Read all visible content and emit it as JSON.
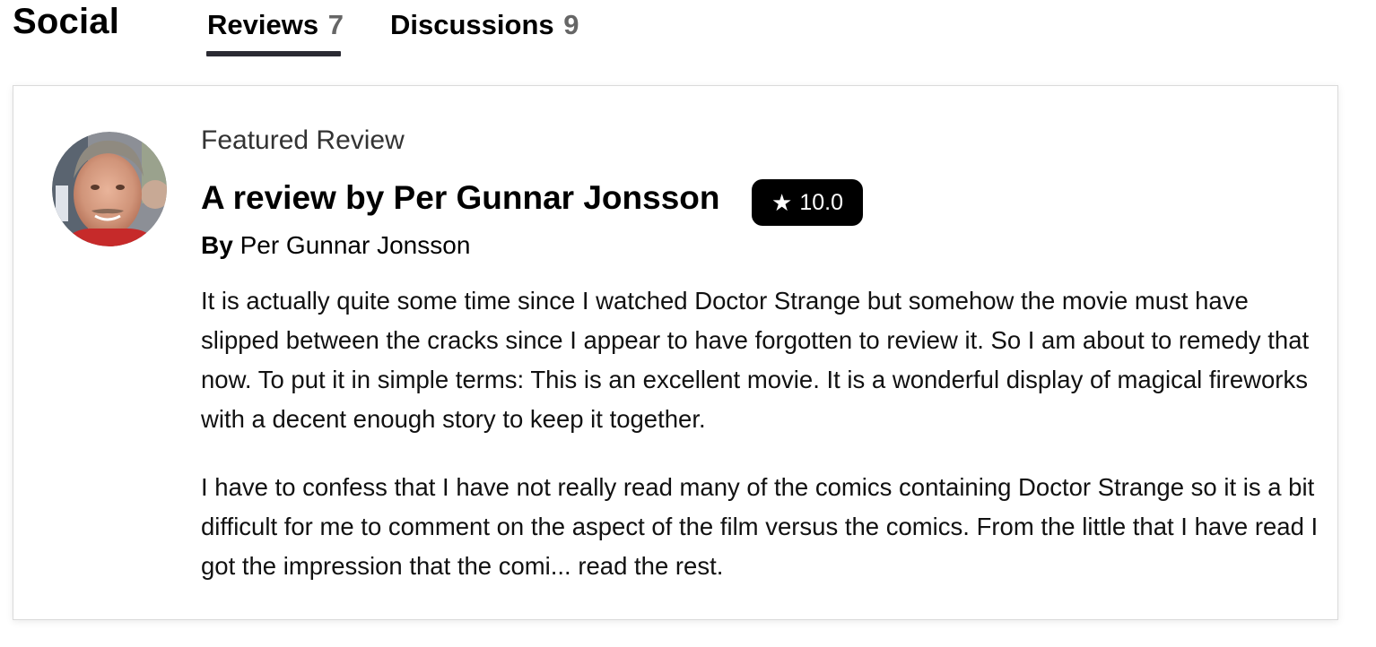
{
  "header": {
    "section_title": "Social",
    "tabs": [
      {
        "label": "Reviews",
        "count": "7",
        "active": true
      },
      {
        "label": "Discussions",
        "count": "9",
        "active": false
      }
    ]
  },
  "review": {
    "featured_label": "Featured Review",
    "title": "A review by Per Gunnar Jonsson",
    "rating_icon": "star-icon",
    "rating": "10.0",
    "by_label": "By",
    "author": "Per Gunnar Jonsson",
    "paragraph1": "It is actually quite some time since I watched Doctor Strange but somehow the movie must have slipped between the cracks since I appear to have forgotten to review it. So I am about to remedy that now. To put it in simple terms: This is an excellent movie. It is a wonderful display of magical fireworks with a decent enough story to keep it together.",
    "paragraph2_text": "I have to confess that I have not really read many of the comics containing Doctor Strange so it is a bit difficult for me to comment on the aspect of the film versus the comics. From the little that I have read I got the impression that the comi...",
    "read_more": "read the rest."
  },
  "colors": {
    "tab_underline": "#2b2b33",
    "rating_badge_bg": "#000000",
    "card_border": "#dadada"
  }
}
